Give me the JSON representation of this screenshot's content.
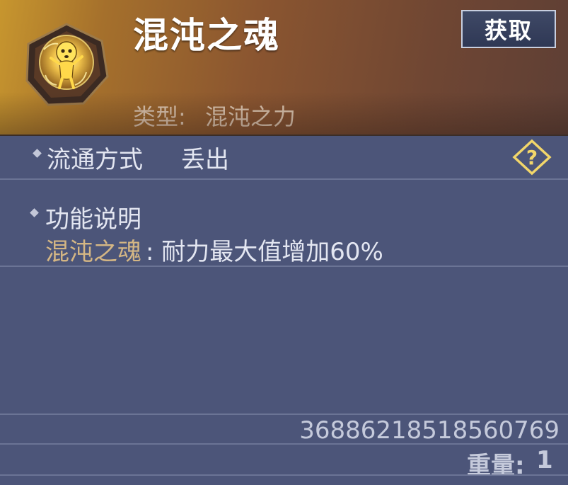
{
  "item": {
    "name": "混沌之魂",
    "type_label": "类型:",
    "type_value": "混沌之力",
    "icon": "golden-soul-medallion-icon"
  },
  "actions": {
    "obtain_label": "获取"
  },
  "circulation": {
    "label": "流通方式",
    "value": "丢出",
    "help_icon": "question-diamond-icon"
  },
  "function": {
    "label": "功能说明",
    "effect_name": "混沌之魂",
    "effect_desc": ": 耐力最大值增加60%"
  },
  "footer": {
    "item_id": "3688621851856​0769",
    "weight_label": "重量:",
    "weight_value": "1"
  },
  "colors": {
    "panel_bg": "#4c5579",
    "header_gold": "#c7962e",
    "header_brown": "#6f4633",
    "title_text": "#ffffff",
    "effect_name_text": "#d4b684",
    "help_icon": "#f2d66a"
  }
}
